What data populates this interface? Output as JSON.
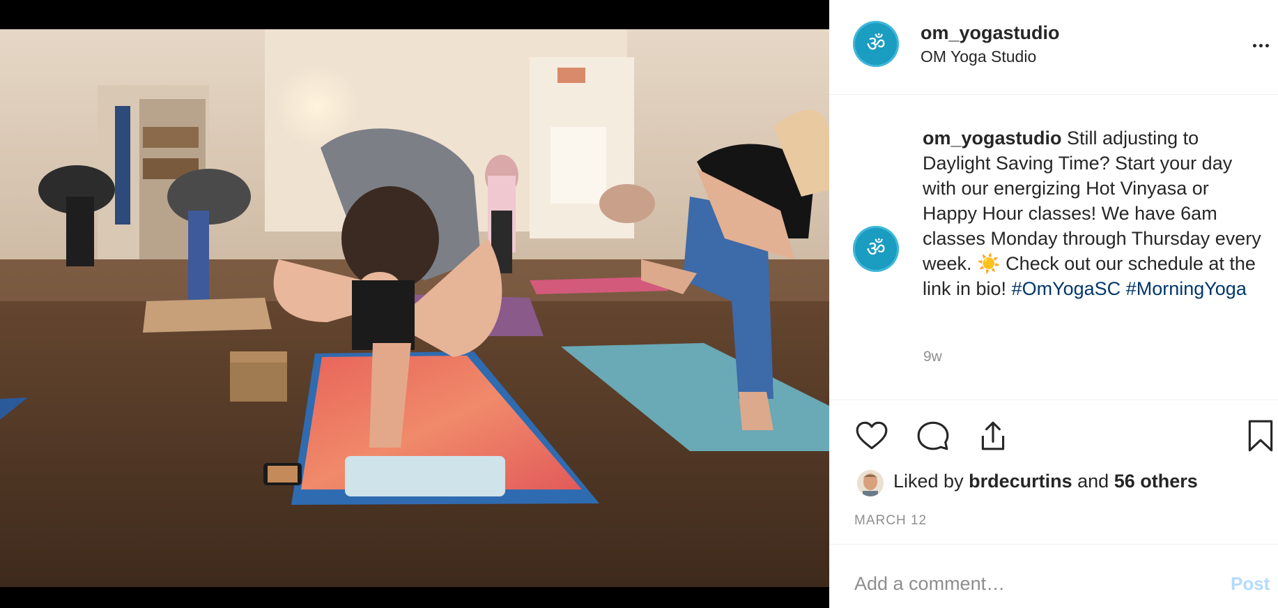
{
  "post": {
    "username": "om_yogastudio",
    "location": "OM Yoga Studio",
    "photo_icon": "photo",
    "avatar_icon": "om-logo-icon",
    "caption": {
      "username": "om_yogastudio",
      "text_part1": " Still adjusting to Daylight Saving Time? Start your day with our energizing Hot Vinyasa or Happy Hour classes! We have 6am classes Monday through Thursday every week. ",
      "emoji": "☀️",
      "text_part2": " Check out our schedule at the link in bio! ",
      "hashtag1": "#OmYogaSC",
      "hashtag2": "#MorningYoga",
      "age": "9w"
    },
    "actions": {
      "like_icon": "heart-icon",
      "comment_icon": "comment-icon",
      "share_icon": "share-icon",
      "save_icon": "bookmark-icon"
    },
    "likes": {
      "prefix": "Liked by",
      "user": "brdecurtins",
      "and": "and",
      "others": "56 others"
    },
    "date": "MARCH 12",
    "comment_box": {
      "placeholder": "Add a comment…",
      "post_label": "Post"
    }
  },
  "colors": {
    "avatar_bg": "#1b9cc1",
    "hashtag": "#00376b",
    "muted": "#8e8e8e",
    "post_button_disabled": "#b3dbff"
  }
}
